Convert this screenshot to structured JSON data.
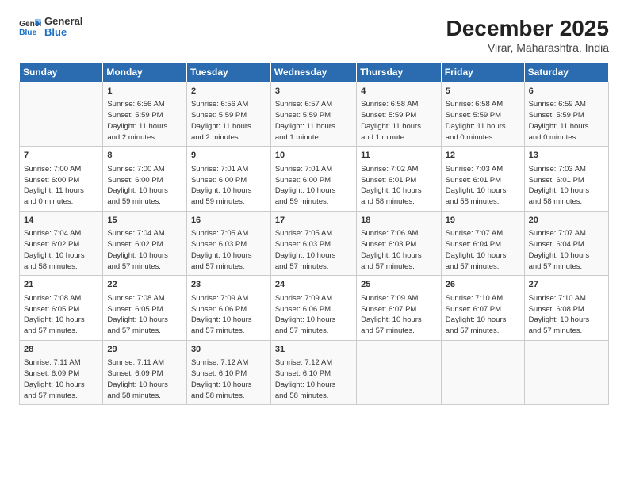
{
  "logo": {
    "line1": "General",
    "line2": "Blue"
  },
  "title": "December 2025",
  "subtitle": "Virar, Maharashtra, India",
  "days_header": [
    "Sunday",
    "Monday",
    "Tuesday",
    "Wednesday",
    "Thursday",
    "Friday",
    "Saturday"
  ],
  "weeks": [
    [
      {
        "num": "",
        "info": ""
      },
      {
        "num": "1",
        "info": "Sunrise: 6:56 AM\nSunset: 5:59 PM\nDaylight: 11 hours\nand 2 minutes."
      },
      {
        "num": "2",
        "info": "Sunrise: 6:56 AM\nSunset: 5:59 PM\nDaylight: 11 hours\nand 2 minutes."
      },
      {
        "num": "3",
        "info": "Sunrise: 6:57 AM\nSunset: 5:59 PM\nDaylight: 11 hours\nand 1 minute."
      },
      {
        "num": "4",
        "info": "Sunrise: 6:58 AM\nSunset: 5:59 PM\nDaylight: 11 hours\nand 1 minute."
      },
      {
        "num": "5",
        "info": "Sunrise: 6:58 AM\nSunset: 5:59 PM\nDaylight: 11 hours\nand 0 minutes."
      },
      {
        "num": "6",
        "info": "Sunrise: 6:59 AM\nSunset: 5:59 PM\nDaylight: 11 hours\nand 0 minutes."
      }
    ],
    [
      {
        "num": "7",
        "info": "Sunrise: 7:00 AM\nSunset: 6:00 PM\nDaylight: 11 hours\nand 0 minutes."
      },
      {
        "num": "8",
        "info": "Sunrise: 7:00 AM\nSunset: 6:00 PM\nDaylight: 10 hours\nand 59 minutes."
      },
      {
        "num": "9",
        "info": "Sunrise: 7:01 AM\nSunset: 6:00 PM\nDaylight: 10 hours\nand 59 minutes."
      },
      {
        "num": "10",
        "info": "Sunrise: 7:01 AM\nSunset: 6:00 PM\nDaylight: 10 hours\nand 59 minutes."
      },
      {
        "num": "11",
        "info": "Sunrise: 7:02 AM\nSunset: 6:01 PM\nDaylight: 10 hours\nand 58 minutes."
      },
      {
        "num": "12",
        "info": "Sunrise: 7:03 AM\nSunset: 6:01 PM\nDaylight: 10 hours\nand 58 minutes."
      },
      {
        "num": "13",
        "info": "Sunrise: 7:03 AM\nSunset: 6:01 PM\nDaylight: 10 hours\nand 58 minutes."
      }
    ],
    [
      {
        "num": "14",
        "info": "Sunrise: 7:04 AM\nSunset: 6:02 PM\nDaylight: 10 hours\nand 58 minutes."
      },
      {
        "num": "15",
        "info": "Sunrise: 7:04 AM\nSunset: 6:02 PM\nDaylight: 10 hours\nand 57 minutes."
      },
      {
        "num": "16",
        "info": "Sunrise: 7:05 AM\nSunset: 6:03 PM\nDaylight: 10 hours\nand 57 minutes."
      },
      {
        "num": "17",
        "info": "Sunrise: 7:05 AM\nSunset: 6:03 PM\nDaylight: 10 hours\nand 57 minutes."
      },
      {
        "num": "18",
        "info": "Sunrise: 7:06 AM\nSunset: 6:03 PM\nDaylight: 10 hours\nand 57 minutes."
      },
      {
        "num": "19",
        "info": "Sunrise: 7:07 AM\nSunset: 6:04 PM\nDaylight: 10 hours\nand 57 minutes."
      },
      {
        "num": "20",
        "info": "Sunrise: 7:07 AM\nSunset: 6:04 PM\nDaylight: 10 hours\nand 57 minutes."
      }
    ],
    [
      {
        "num": "21",
        "info": "Sunrise: 7:08 AM\nSunset: 6:05 PM\nDaylight: 10 hours\nand 57 minutes."
      },
      {
        "num": "22",
        "info": "Sunrise: 7:08 AM\nSunset: 6:05 PM\nDaylight: 10 hours\nand 57 minutes."
      },
      {
        "num": "23",
        "info": "Sunrise: 7:09 AM\nSunset: 6:06 PM\nDaylight: 10 hours\nand 57 minutes."
      },
      {
        "num": "24",
        "info": "Sunrise: 7:09 AM\nSunset: 6:06 PM\nDaylight: 10 hours\nand 57 minutes."
      },
      {
        "num": "25",
        "info": "Sunrise: 7:09 AM\nSunset: 6:07 PM\nDaylight: 10 hours\nand 57 minutes."
      },
      {
        "num": "26",
        "info": "Sunrise: 7:10 AM\nSunset: 6:07 PM\nDaylight: 10 hours\nand 57 minutes."
      },
      {
        "num": "27",
        "info": "Sunrise: 7:10 AM\nSunset: 6:08 PM\nDaylight: 10 hours\nand 57 minutes."
      }
    ],
    [
      {
        "num": "28",
        "info": "Sunrise: 7:11 AM\nSunset: 6:09 PM\nDaylight: 10 hours\nand 57 minutes."
      },
      {
        "num": "29",
        "info": "Sunrise: 7:11 AM\nSunset: 6:09 PM\nDaylight: 10 hours\nand 58 minutes."
      },
      {
        "num": "30",
        "info": "Sunrise: 7:12 AM\nSunset: 6:10 PM\nDaylight: 10 hours\nand 58 minutes."
      },
      {
        "num": "31",
        "info": "Sunrise: 7:12 AM\nSunset: 6:10 PM\nDaylight: 10 hours\nand 58 minutes."
      },
      {
        "num": "",
        "info": ""
      },
      {
        "num": "",
        "info": ""
      },
      {
        "num": "",
        "info": ""
      }
    ]
  ]
}
